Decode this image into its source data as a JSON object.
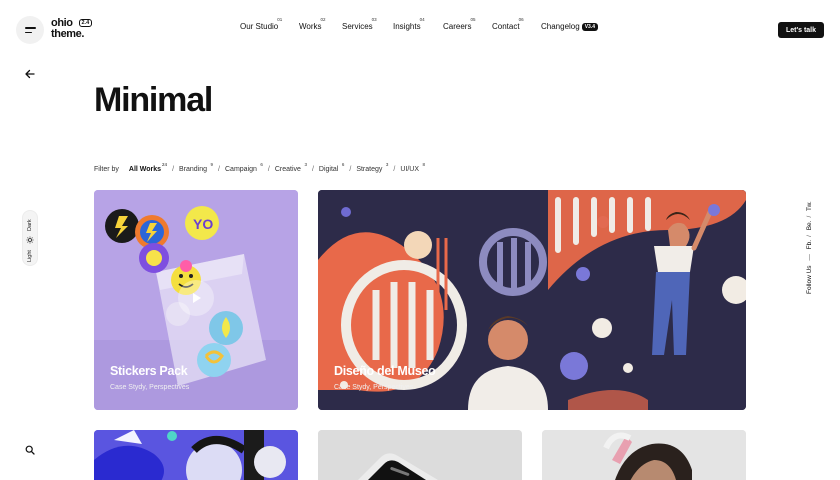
{
  "header": {
    "logo_line1": "ohio",
    "logo_line2": "theme.",
    "logo_version": "2.4",
    "nav": [
      {
        "label": "Our Studio",
        "num": "01"
      },
      {
        "label": "Works",
        "num": "02"
      },
      {
        "label": "Services",
        "num": "03"
      },
      {
        "label": "Insights",
        "num": "04"
      },
      {
        "label": "Careers",
        "num": "05"
      },
      {
        "label": "Contact",
        "num": "06"
      },
      {
        "label": "Changelog",
        "badge": "V3.4"
      }
    ],
    "cta_label": "Let's talk"
  },
  "rail": {
    "theme_light": "Light",
    "theme_dark": "Dark",
    "social": {
      "prefix": "Follow Us",
      "dash": "—",
      "links": [
        "Fb.",
        "Be.",
        "Tw."
      ]
    }
  },
  "page": {
    "title": "Minimal"
  },
  "filters": {
    "label": "Filter by",
    "items": [
      {
        "label": "All Works",
        "count": "24",
        "active": true
      },
      {
        "label": "Branding",
        "count": "9"
      },
      {
        "label": "Campaign",
        "count": "6"
      },
      {
        "label": "Creative",
        "count": "3"
      },
      {
        "label": "Digital",
        "count": "6"
      },
      {
        "label": "Strategy",
        "count": "3"
      },
      {
        "label": "UI/UX",
        "count": "8"
      }
    ]
  },
  "cards": [
    {
      "title": "Stickers Pack",
      "subtitle": "Case Stydy, Perspectives"
    },
    {
      "title": "Diseño del Museo",
      "subtitle": "Case Stydy, Perspectives"
    }
  ],
  "icons": [
    "menu-icon",
    "back-arrow-icon",
    "sun-icon",
    "search-icon",
    "play-icon"
  ],
  "colors": {
    "accent": "#111111",
    "sticker_bg": "#b9a6e8",
    "museum_bg": "#2e2c4a",
    "museum_accent": "#e8694a"
  }
}
